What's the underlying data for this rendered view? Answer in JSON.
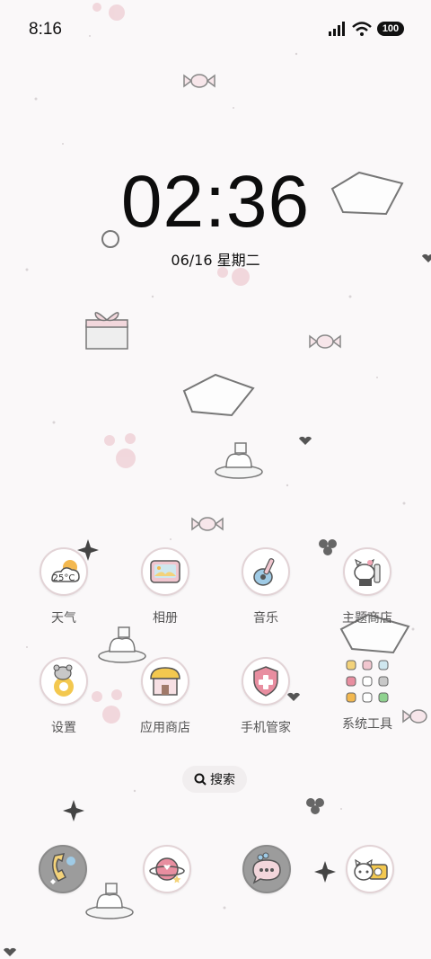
{
  "status_bar": {
    "time": "8:16",
    "battery": "100"
  },
  "lock": {
    "clock": "02:36",
    "date": "06/16 星期二"
  },
  "apps": [
    {
      "label": "天气",
      "icon": "weather-icon",
      "badge": "25°C"
    },
    {
      "label": "相册",
      "icon": "gallery-icon"
    },
    {
      "label": "音乐",
      "icon": "music-icon"
    },
    {
      "label": "主题商店",
      "icon": "theme-store-icon"
    },
    {
      "label": "设置",
      "icon": "settings-icon"
    },
    {
      "label": "应用商店",
      "icon": "app-store-icon"
    },
    {
      "label": "手机管家",
      "icon": "phone-manager-icon"
    },
    {
      "label": "系统工具",
      "icon": "system-tools-folder-icon"
    }
  ],
  "search": {
    "label": "搜索"
  },
  "dock": [
    {
      "icon": "phone-icon"
    },
    {
      "icon": "browser-icon"
    },
    {
      "icon": "messages-icon"
    },
    {
      "icon": "camera-icon"
    }
  ],
  "colors": {
    "background": "#faf8f9",
    "icon_border": "#e2d3d6",
    "accent_pink": "#e88ea0"
  }
}
